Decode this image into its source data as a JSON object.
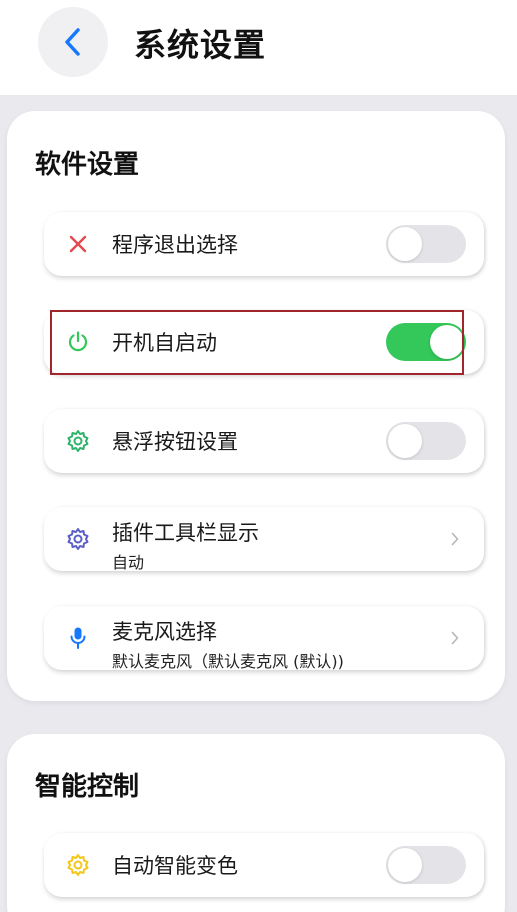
{
  "header": {
    "title": "系统设置"
  },
  "sections": [
    {
      "title": "软件设置",
      "items": [
        {
          "label": "程序退出选择",
          "control": "toggle",
          "on": false,
          "icon": "close-icon"
        },
        {
          "label": "开机自启动",
          "control": "toggle",
          "on": true,
          "icon": "power-icon"
        },
        {
          "label": "悬浮按钮设置",
          "control": "toggle",
          "on": false,
          "icon": "gear-icon"
        },
        {
          "label": "插件工具栏显示",
          "sub": "自动",
          "control": "chevron",
          "icon": "gear-icon"
        },
        {
          "label": "麦克风选择",
          "sub": "默认麦克风（默认麦克风 (默认))",
          "control": "chevron",
          "icon": "microphone-icon"
        }
      ]
    },
    {
      "title": "智能控制",
      "items": [
        {
          "label": "自动智能变色",
          "control": "toggle",
          "on": false,
          "icon": "gear-icon"
        }
      ]
    }
  ],
  "colors": {
    "accent_blue": "#1677ff",
    "toggle_on": "#34c759",
    "toggle_off": "#e4e4e8",
    "close_red": "#e5484d",
    "power_green": "#34c759",
    "gear_green": "#2fb36b",
    "gear_purple": "#5b5fc7",
    "mic_blue": "#1677ff",
    "gear_yellow": "#f5c518",
    "highlight_border": "#a0262b"
  }
}
